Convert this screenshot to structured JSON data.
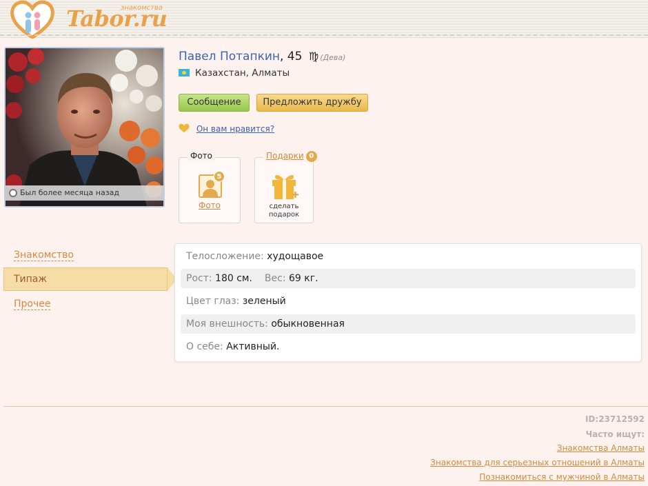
{
  "header": {
    "logo_text": "Tabor.ru",
    "logo_sub": "знакомства"
  },
  "photo": {
    "status": "Был более месяца назад"
  },
  "profile": {
    "name": "Павел Потапкин",
    "age": ", 45",
    "zodiac_symbol": "♍",
    "zodiac_name": "(Дева)",
    "location": "Казахстан, Алматы"
  },
  "actions": {
    "message_label": "Сообщение",
    "friend_label": "Предложить дружбу",
    "like_label": "Он вам нравится?"
  },
  "boxes": {
    "photo_title": "Фото",
    "photo_count": "5",
    "photo_caption": "Фото",
    "gift_title": "Подарки",
    "gift_count": "0",
    "gift_caption_1": "сделать",
    "gift_caption_2": "подарок"
  },
  "menu": {
    "items": [
      "Знакомство",
      "Типаж",
      "Прочее"
    ],
    "active": "Типаж"
  },
  "info": {
    "build_label": "Телосложение:",
    "build_value": "худощавое",
    "height_label": "Рост:",
    "height_value": "180 см.",
    "weight_label": "Вес:",
    "weight_value": "69 кг.",
    "eyes_label": "Цвет глаз:",
    "eyes_value": "зеленый",
    "appearance_label": "Моя внешность:",
    "appearance_value": "обыкновенная",
    "about_label": "О себе:",
    "about_value": "Активный."
  },
  "footer": {
    "id": "ID:23712592",
    "often_searched": "Часто ищут:",
    "links": [
      "Знакомства Алматы",
      "Знакомства для серьезных отношений в Алматы",
      "Познакомиться с мужчиной в Алматы"
    ]
  },
  "colors": {
    "accent": "#d4893d",
    "link_blue": "#3a63b6",
    "background": "#fdf2ee"
  }
}
